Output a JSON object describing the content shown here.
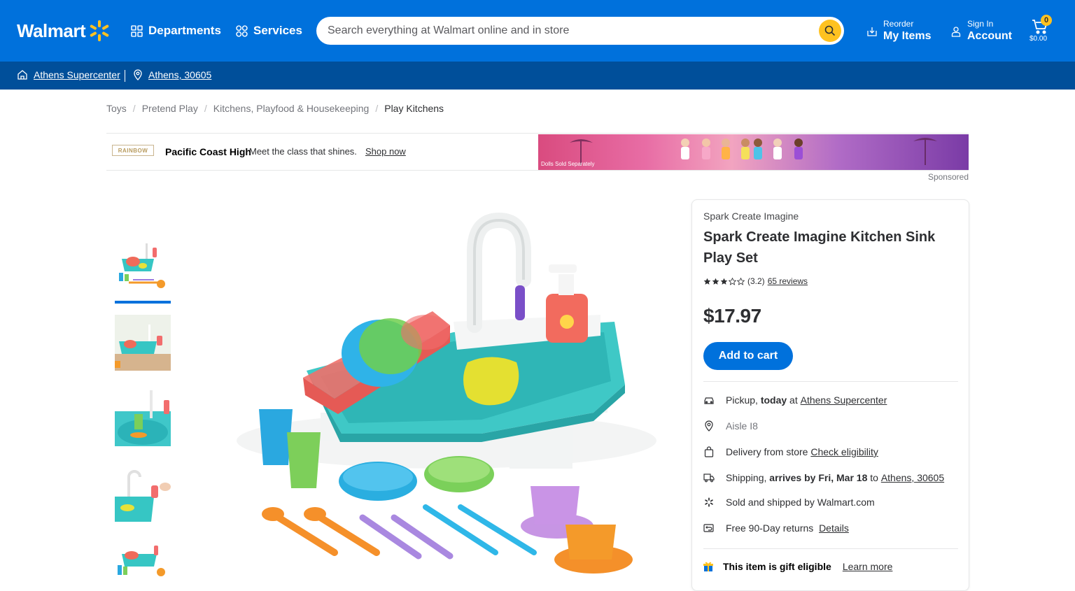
{
  "header": {
    "brand": "Walmart",
    "departments_label": "Departments",
    "services_label": "Services",
    "search_placeholder": "Search everything at Walmart online and in store",
    "reorder_small": "Reorder",
    "reorder_big": "My Items",
    "signin_small": "Sign In",
    "signin_big": "Account",
    "cart_count": "0",
    "cart_total": "$0.00",
    "colors": {
      "primary": "#0071dc",
      "accent": "#ffc220",
      "subbar": "#004f9a"
    }
  },
  "subbar": {
    "store": "Athens Supercenter",
    "location": "Athens, 30605"
  },
  "breadcrumb": [
    "Toys",
    "Pretend Play",
    "Kitchens, Playfood & Housekeeping",
    "Play Kitchens"
  ],
  "ad": {
    "logo_text": "RAINBOW",
    "brand": "Pacific Coast High",
    "text": "Meet the class that shines.",
    "cta": "Shop now",
    "disclaimer": "Dolls Sold Separately",
    "sponsored": "Sponsored"
  },
  "product": {
    "brand": "Spark Create Imagine",
    "title": "Spark Create Imagine Kitchen Sink Play Set",
    "rating_value": "(3.2)",
    "rating": 3.2,
    "reviews": "65 reviews",
    "price": "$17.97",
    "add_to_cart": "Add to cart",
    "thumbnail_count": 5,
    "selected_thumbnail": 1
  },
  "fulfillment": {
    "pickup_prefix": "Pickup,",
    "pickup_when": "today",
    "pickup_at": "at",
    "pickup_store": "Athens Supercenter",
    "aisle": "Aisle I8",
    "delivery_prefix": "Delivery from store",
    "delivery_link": "Check eligibility",
    "shipping_prefix": "Shipping,",
    "shipping_arrives": "arrives by Fri, Mar 18",
    "shipping_to": "to",
    "shipping_location": "Athens, 30605",
    "sold_by": "Sold and shipped by Walmart.com",
    "returns": "Free 90-Day returns",
    "returns_link": "Details",
    "gift_text": "This item is gift eligible",
    "gift_link": "Learn more"
  }
}
